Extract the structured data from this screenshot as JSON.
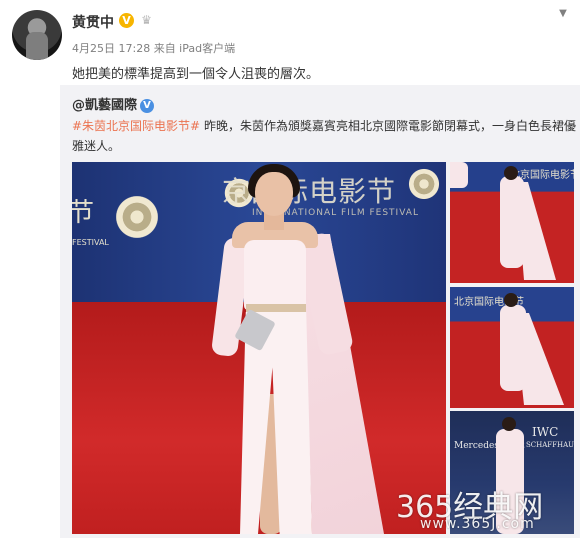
{
  "post": {
    "username": "黄贯中",
    "verified_badge": "V",
    "member_icon": "crown-icon",
    "meta": "4月25日 17:28 来自 iPad客户端",
    "text": "她把美的標準提高到一個令人沮喪的層次。"
  },
  "repost": {
    "original_user": "@凱藝國際",
    "verified_badge": "V",
    "hashtag": "#朱茵北京国际电影节#",
    "text": " 昨晚，朱茵作為頒獎嘉賓亮相北京國際電影節閉幕式，一身白色長裙優雅迷人。"
  },
  "photo": {
    "backdrop_text": "京国际电影节",
    "backdrop_sub": "INTERNATIONAL FILM FESTIVAL",
    "left_backdrop_text": "节",
    "left_backdrop_sub": "FESTIVAL",
    "thumb1_text": "北京国际电影节",
    "thumb2_text": "北京国际电影节",
    "thumb3_brand1": "Mercedes-Benz",
    "thumb3_brand2": "IWC",
    "thumb3_brand3": "SCHAFFHAUSEN"
  },
  "watermark": {
    "text": "365经典网",
    "url": "www.365J.com"
  },
  "colors": {
    "hashtag": "#eb7350",
    "repost_bg": "#f2f2f5",
    "carpet": "#c62222",
    "backdrop": "#233d8a"
  }
}
